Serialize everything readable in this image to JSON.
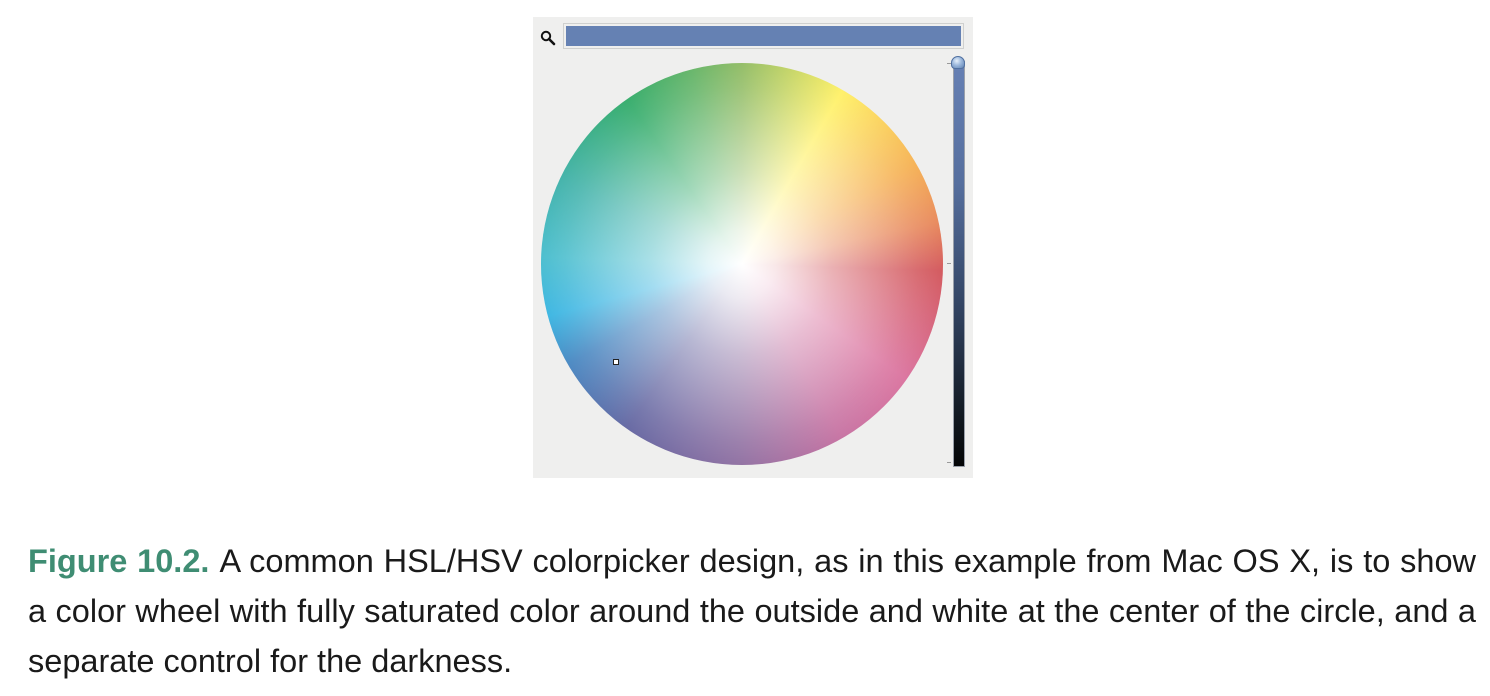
{
  "picker": {
    "icons": {
      "magnifier": "magnifier-icon"
    },
    "selected_color": "#6581b3",
    "panel_background": "#efefee",
    "brightness_level": 1.0
  },
  "caption": {
    "label": "Figure 10.2.",
    "text": "A common HSL/HSV colorpicker design, as in this example from Mac OS X, is to show a color wheel with fully saturated color around the outside and white at the center of the circle, and a separate control for the darkness.",
    "label_color": "#3f8d73"
  }
}
